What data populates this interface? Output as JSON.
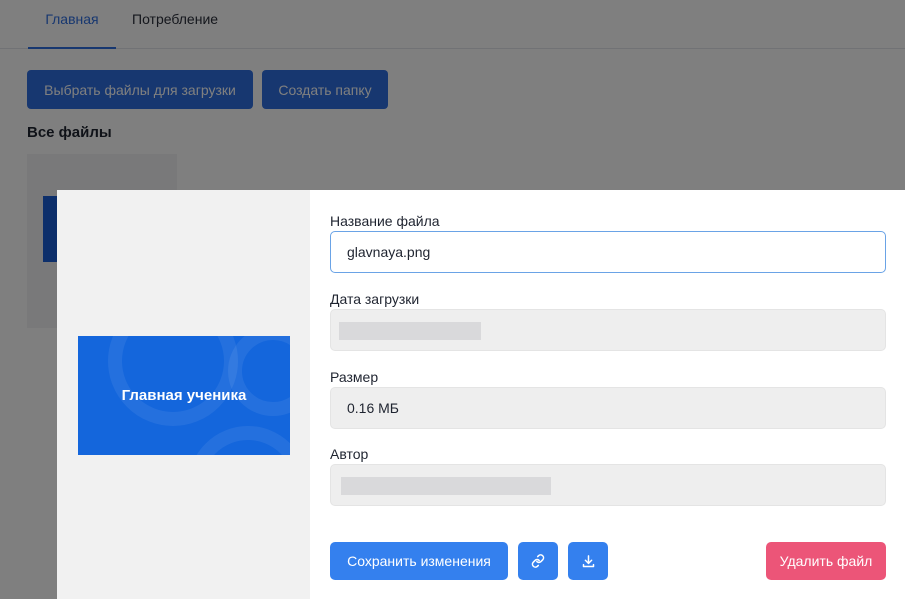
{
  "tabs": [
    {
      "label": "Главная",
      "active": true
    },
    {
      "label": "Потребление",
      "active": false
    }
  ],
  "toolbar": {
    "pick_files_label": "Выбрать файлы для загрузки",
    "create_folder_label": "Создать папку"
  },
  "files_section": {
    "title": "Все файлы"
  },
  "modal": {
    "preview": {
      "image_text": "Главная ученика"
    },
    "fields": {
      "name_label": "Название файла",
      "name_value": "glavnaya.png",
      "date_label": "Дата загрузки",
      "size_label": "Размер",
      "size_value": "0.16 МБ",
      "author_label": "Автор"
    },
    "actions": {
      "save_label": "Сохранить изменения",
      "link_icon": "link-icon",
      "download_icon": "download-icon",
      "delete_label": "Удалить файл"
    }
  },
  "colors": {
    "primary": "#3480ee",
    "danger": "#ec5578",
    "tab_active": "#2f6fe0",
    "preview_bg": "#1466dc"
  }
}
